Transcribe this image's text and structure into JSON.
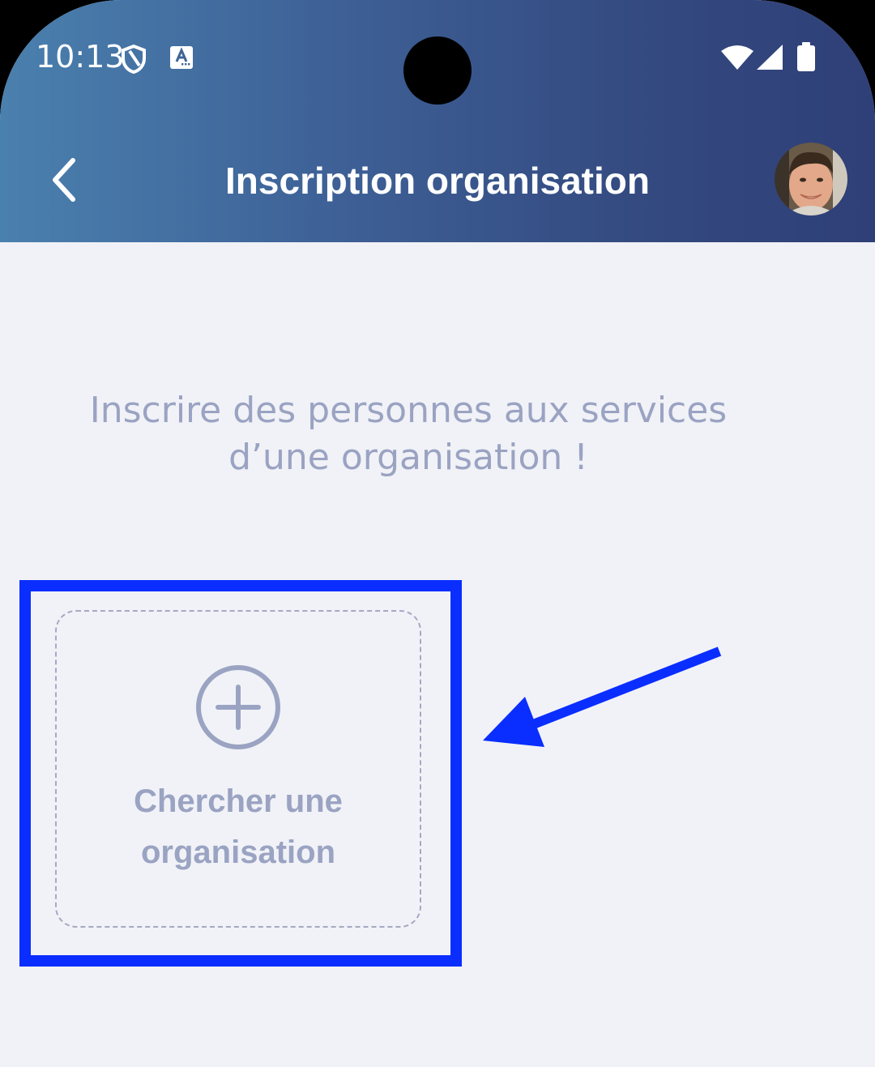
{
  "status_bar": {
    "time": "10:13",
    "icons": [
      "shield-icon",
      "text-a-icon",
      "wifi-icon",
      "signal-icon",
      "battery-icon"
    ]
  },
  "header": {
    "title": "Inscription organisation",
    "back_icon": "chevron-left-icon",
    "avatar": "user-avatar"
  },
  "main": {
    "intro_line1": "Inscrire des personnes aux services",
    "intro_line2": "d’une organisation !",
    "card": {
      "icon": "plus-circle-icon",
      "label_line1": "Chercher une",
      "label_line2": "organisation"
    }
  },
  "annotation": {
    "highlight_color": "#0a2eff",
    "arrow_color": "#0a2eff"
  },
  "colors": {
    "header_start": "#4a80ae",
    "header_end": "#2f3f78",
    "background": "#f1f2f7",
    "muted_text": "#9aa3c2"
  }
}
